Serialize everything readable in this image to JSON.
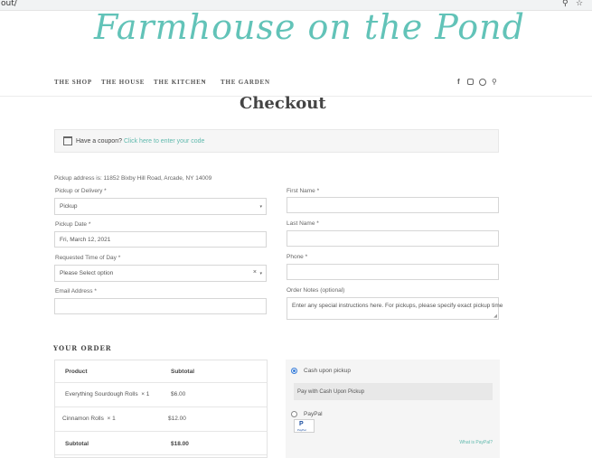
{
  "browser": {
    "url": "out/"
  },
  "site": {
    "logo": "Farmhouse on the Pond"
  },
  "nav": {
    "items": [
      "THE SHOP",
      "THE HOUSE",
      "THE KITCHEN",
      "THE GARDEN"
    ],
    "kitchen_caret": "⌄"
  },
  "page": {
    "title": "Checkout"
  },
  "coupon": {
    "text": "Have a coupon?",
    "link": "Click here to enter your code"
  },
  "pickup_address": "Pickup address is: 11852 Bixby Hill Road, Arcade, NY 14009",
  "form": {
    "pickup_label": "Pickup or Delivery *",
    "pickup_value": "Pickup",
    "date_label": "Pickup Date *",
    "date_value": "Fri, March 12, 2021",
    "time_label": "Requested Time of Day *",
    "time_value": "Please Select option",
    "time_clear": "×",
    "email_label": "Email Address *",
    "email_value": "",
    "first_label": "First Name *",
    "first_value": "",
    "last_label": "Last Name *",
    "last_value": "",
    "phone_label": "Phone *",
    "phone_value": "",
    "notes_label": "Order Notes (optional)",
    "notes_placeholder": "Enter any special instructions here. For pickups, please specify exact pickup time"
  },
  "order": {
    "heading": "YOUR ORDER",
    "col_product": "Product",
    "col_subtotal": "Subtotal",
    "rows": [
      {
        "product": "Everything Sourdough Rolls",
        "qty": "× 1",
        "subtotal": "$6.00"
      },
      {
        "product": "Cinnamon Rolls",
        "qty": "× 1",
        "subtotal": "$12.00"
      }
    ],
    "subtotal_label": "Subtotal",
    "subtotal_value": "$18.00"
  },
  "payment": {
    "cash_label": "Cash upon pickup",
    "cash_desc": "Pay with Cash Upon Pickup",
    "paypal_label": "PayPal",
    "paypal_logo": "PayPal",
    "what_is": "What is PayPal?"
  },
  "colors": {
    "accent": "#5fb9ad",
    "logo": "#62c3b8"
  }
}
